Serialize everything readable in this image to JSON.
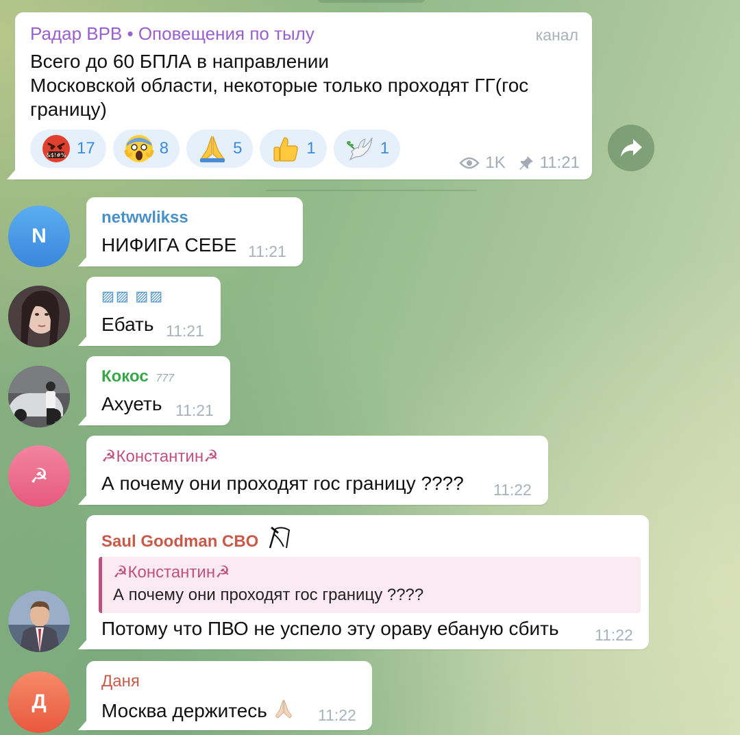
{
  "channel_post": {
    "title": "Радар ВРВ • Оповещения по тылу",
    "label": "канал",
    "text_lines": [
      "Всего до 60 БПЛА в направлении",
      "Московской области, некоторые только проходят ГГ(гос",
      "границу)"
    ],
    "reactions": [
      {
        "icon": "angry-cursing-face-icon",
        "count": "17"
      },
      {
        "icon": "screaming-face-icon",
        "count": "8"
      },
      {
        "icon": "folded-hands-icon",
        "count": "5"
      },
      {
        "icon": "thumbs-up-icon",
        "count": "1"
      },
      {
        "icon": "dove-icon",
        "count": "1"
      }
    ],
    "views": "1K",
    "time": "11:21"
  },
  "messages": [
    {
      "sender": "netwwlikss",
      "sender_color": "#4a90c8",
      "avatar_letter": "N",
      "avatar_color": "#4a9ae8",
      "text": "НИФИГА СЕБЕ",
      "time": "11:21"
    },
    {
      "sender": "▨▨ ▨▨",
      "sender_color": "#4a90c8",
      "avatar_letter": "",
      "text": "Ебать",
      "time": "11:21"
    },
    {
      "sender": "Кокос",
      "sender_badge": "777",
      "sender_color": "#3aa64a",
      "avatar_letter": "",
      "text": "Ахуеть",
      "time": "11:21"
    },
    {
      "sender": "☭Константин☭",
      "sender_color": "#c0517e",
      "avatar_letter": "☭",
      "avatar_color": "#ee6d8e",
      "text": "А почему они проходят гос границу ????",
      "time": "11:22"
    },
    {
      "sender": "Saul Goodman CBO",
      "sender_color": "#c85a4a",
      "avatar_letter": "",
      "reply": {
        "name": "☭Константин☭",
        "text": "А почему они проходят гос границу ????"
      },
      "text": "Потому что ПВО не успело эту ораву ебаную сбить",
      "time": "11:22"
    },
    {
      "sender": "Даня",
      "sender_color": "#c85a4a",
      "avatar_letter": "Д",
      "avatar_color": "#ef6a4c",
      "text": "Москва держитесь",
      "time": "11:22"
    }
  ]
}
